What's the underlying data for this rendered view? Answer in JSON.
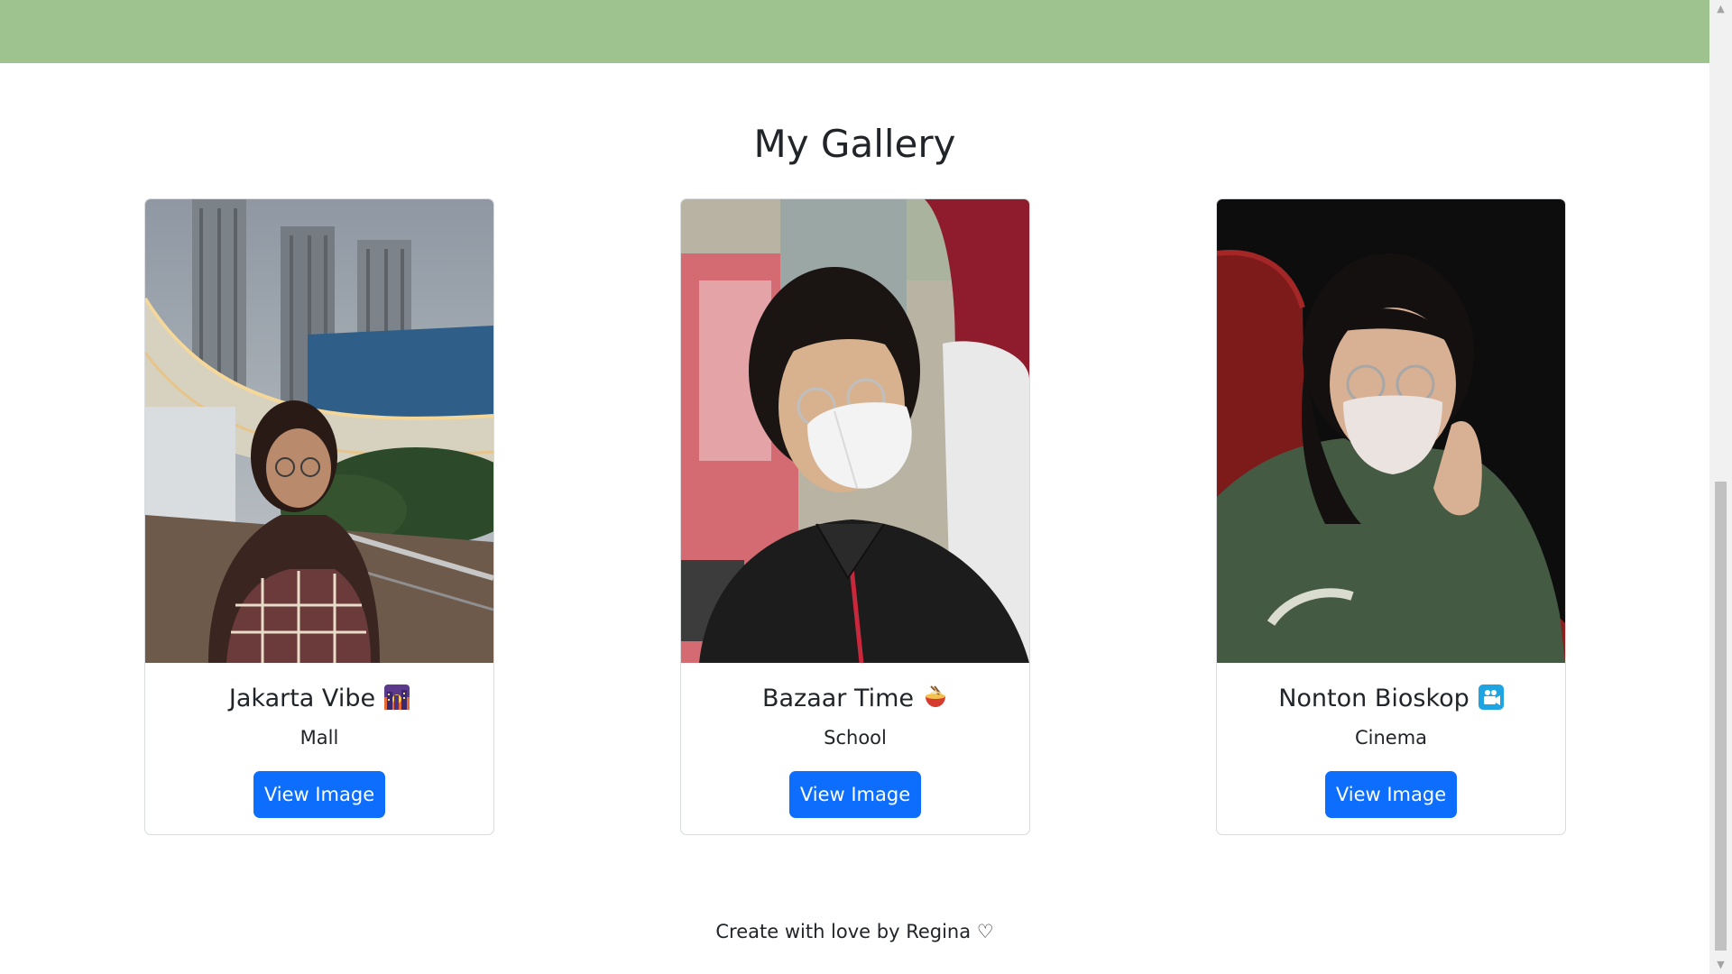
{
  "page": {
    "heading": "My Gallery",
    "footer": "Create with love by Regina ♡"
  },
  "colors": {
    "top_band": "#9ec38f",
    "button": "#0d6efd",
    "text": "#212529"
  },
  "cards": [
    {
      "title": "Jakarta Vibe",
      "emoji_icon": "city-sunset-icon",
      "subtitle": "Mall",
      "button_label": "View Image",
      "photo": "woman-in-plaid-shirt-near-tall-buildings-at-dusk"
    },
    {
      "title": "Bazaar Time",
      "emoji_icon": "noodle-bowl-icon",
      "subtitle": "School",
      "button_label": "View Image",
      "photo": "woman-with-glasses-and-white-mask-in-black-jacket"
    },
    {
      "title": "Nonton Bioskop",
      "emoji_icon": "movie-camera-icon",
      "subtitle": "Cinema",
      "button_label": "View Image",
      "photo": "woman-with-glasses-and-mask-in-cinema-seat"
    }
  ]
}
